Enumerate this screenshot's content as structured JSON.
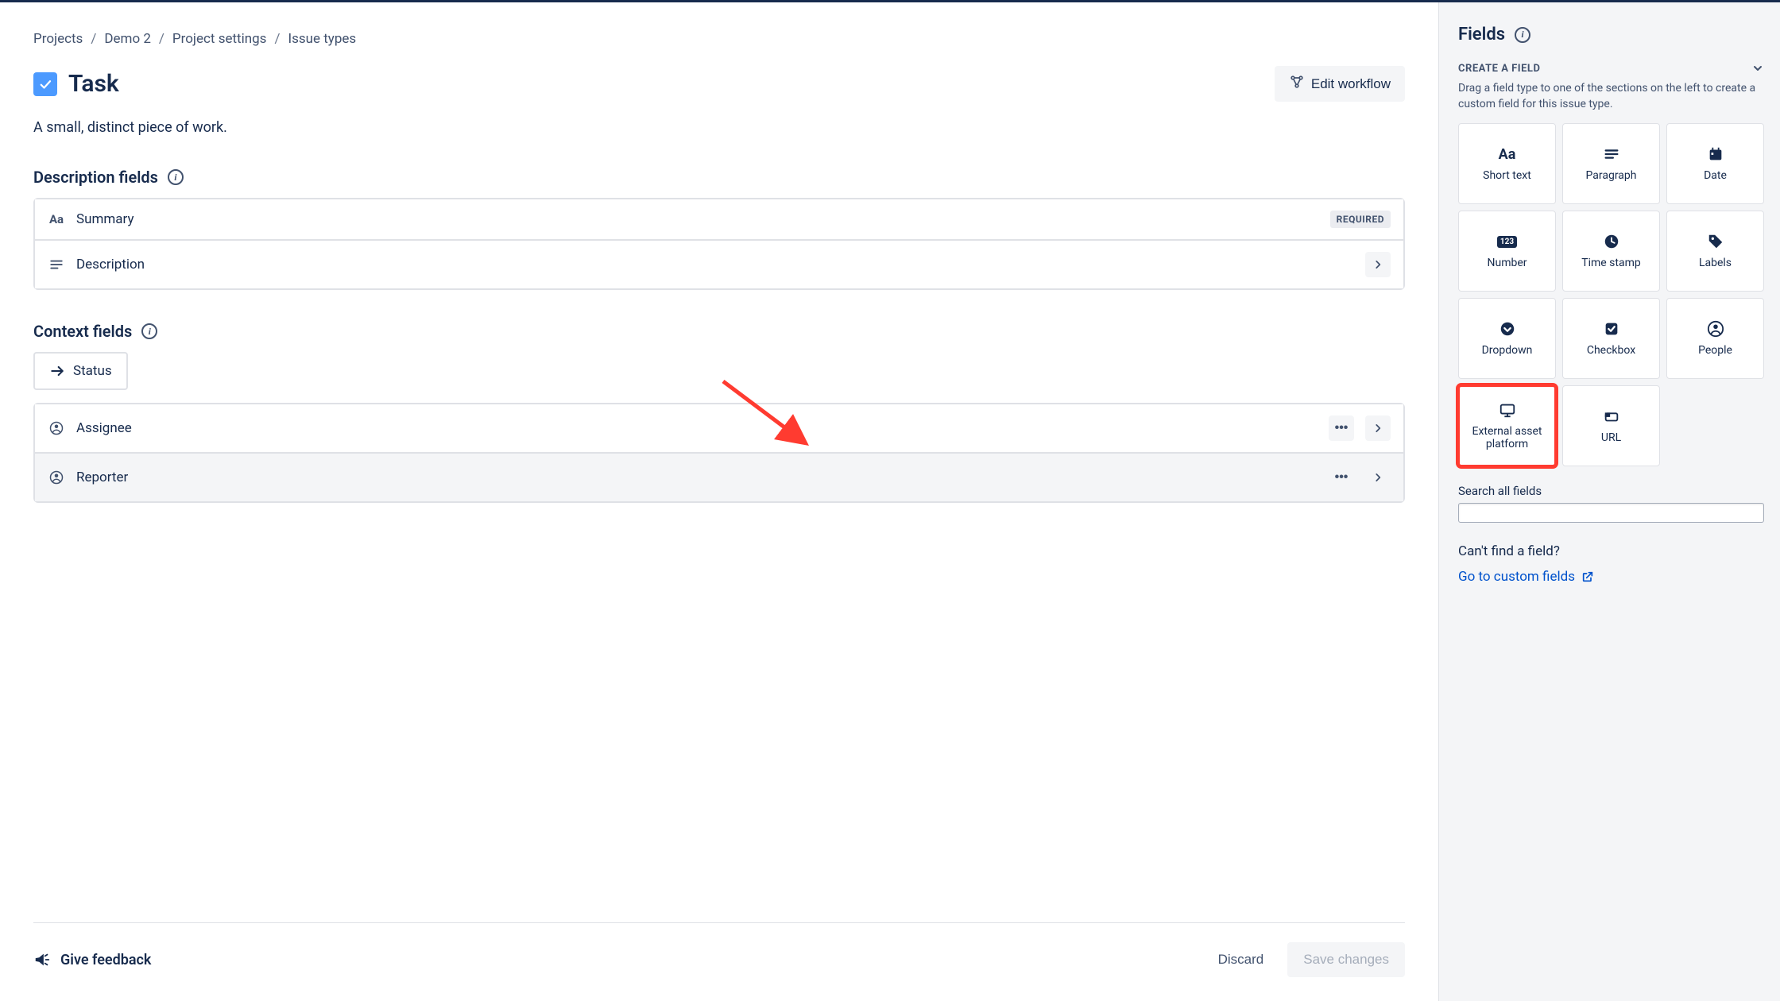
{
  "breadcrumbs": [
    "Projects",
    "Demo 2",
    "Project settings",
    "Issue types"
  ],
  "page": {
    "title": "Task",
    "subtitle": "A small, distinct piece of work.",
    "edit_workflow": "Edit workflow"
  },
  "sections": {
    "description": {
      "title": "Description fields",
      "fields": [
        {
          "name": "Summary",
          "required_label": "REQUIRED"
        },
        {
          "name": "Description"
        }
      ]
    },
    "context": {
      "title": "Context fields",
      "status_label": "Status",
      "fields": [
        {
          "name": "Assignee"
        },
        {
          "name": "Reporter"
        }
      ]
    }
  },
  "footer": {
    "feedback": "Give feedback",
    "discard": "Discard",
    "save": "Save changes"
  },
  "sidebar": {
    "title": "Fields",
    "create_label": "CREATE A FIELD",
    "helper": "Drag a field type to one of the sections on the left to create a custom field for this issue type.",
    "tiles": [
      {
        "label": "Short text"
      },
      {
        "label": "Paragraph"
      },
      {
        "label": "Date"
      },
      {
        "label": "Number"
      },
      {
        "label": "Time stamp"
      },
      {
        "label": "Labels"
      },
      {
        "label": "Dropdown"
      },
      {
        "label": "Checkbox"
      },
      {
        "label": "People"
      },
      {
        "label": "External asset platform"
      },
      {
        "label": "URL"
      }
    ],
    "search_label": "Search all fields",
    "cant_find": "Can't find a field?",
    "custom_link": "Go to custom fields"
  }
}
